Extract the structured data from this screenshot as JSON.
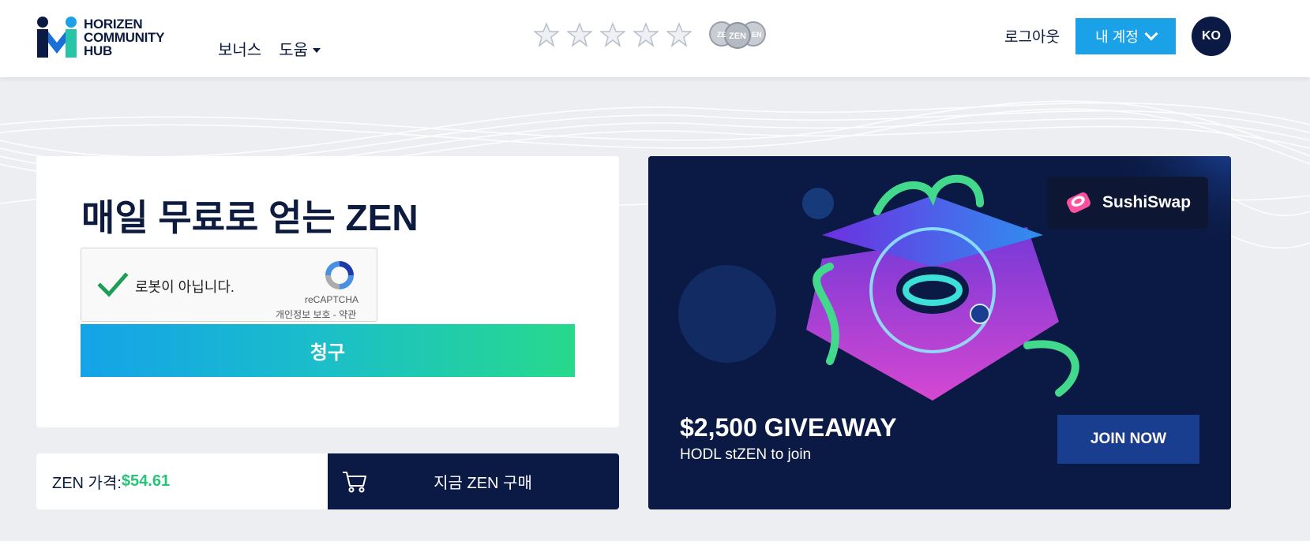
{
  "header": {
    "logo_lines": [
      "HORIZEN",
      "COMMUNITY",
      "HUB"
    ],
    "nav": [
      {
        "label": "보너스",
        "has_dropdown": false
      },
      {
        "label": "도움",
        "has_dropdown": true
      }
    ],
    "rating_stars": 5,
    "rating_filled": 0,
    "coin_label": "ZEN",
    "logout_label": "로그아웃",
    "account_label": "내 계정",
    "lang_label": "KO"
  },
  "faucet": {
    "title": "매일 무료로 얻는 ZEN",
    "recaptcha": {
      "label": "로봇이 아닙니다.",
      "brand": "reCAPTCHA",
      "terms": "개인정보 보호 - 약관",
      "checked": true
    },
    "claim_label": "청구"
  },
  "price": {
    "label": "ZEN 가격: ",
    "value": "$54.61",
    "buy_label": "지금 ZEN 구매"
  },
  "banner": {
    "partner": "SushiSwap",
    "title": "$2,500 GIVEAWAY",
    "subtitle": "HODL stZEN to join",
    "cta": "JOIN NOW"
  },
  "colors": {
    "navy": "#0a1a44",
    "accent_blue": "#1aa1e8",
    "accent_green": "#27c478"
  }
}
